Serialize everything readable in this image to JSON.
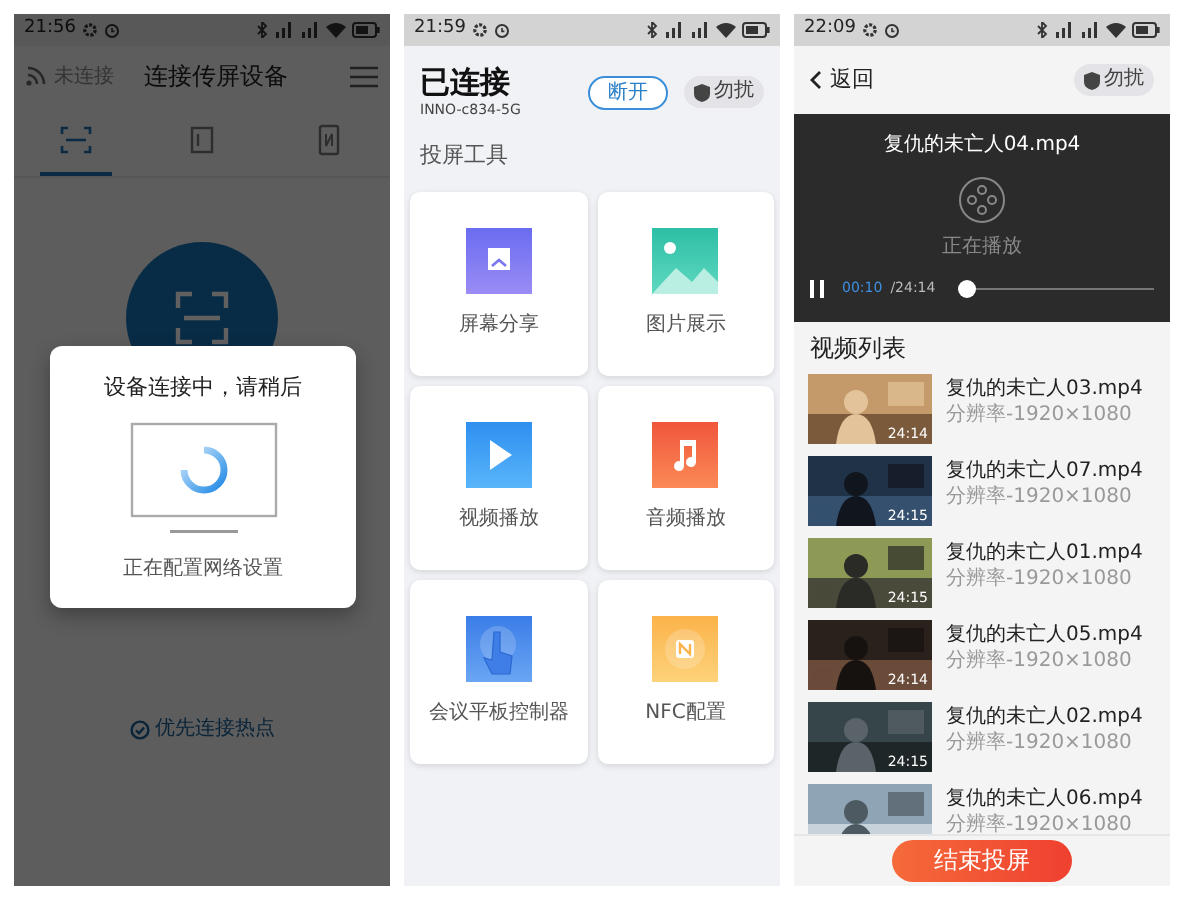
{
  "connect_screen": {
    "status_bar": {
      "time": "21:56"
    },
    "header": {
      "status": "未连接",
      "title": "连接传屏设备"
    },
    "tabs": [
      {
        "selected": true
      },
      {
        "selected": false
      },
      {
        "selected": false
      }
    ],
    "dialog": {
      "title": "设备连接中，请稍后",
      "message": "正在配置网络设置"
    },
    "hotspot_link": "优先连接热点"
  },
  "tools_screen": {
    "status_bar": {
      "time": "21:59"
    },
    "connection": {
      "status": "已连接",
      "network": "INNO-c834-5G"
    },
    "disconnect_button": "断开",
    "dnd_chip": "勿扰",
    "section_title": "投屏工具",
    "tools": [
      {
        "label": "屏幕分享",
        "kind": "screen"
      },
      {
        "label": "图片展示"
      },
      {
        "label": "视频播放",
        "kind": "video"
      },
      {
        "label": "音频播放",
        "kind": "audio"
      },
      {
        "label": "会议平板控制器",
        "kind": "touch"
      },
      {
        "label": "NFC配置",
        "kind": "nfc"
      }
    ]
  },
  "player_screen": {
    "status_bar": {
      "time": "22:09"
    },
    "back_button": "返回",
    "dnd_chip": "勿扰",
    "player": {
      "title": "复仇的未亡人04.mp4",
      "status": "正在播放",
      "elapsed": "00:10",
      "total": "/24:14",
      "level": 0.03
    },
    "list_title": "视频列表",
    "videos": [
      {
        "title": "复仇的未亡人03.mp4",
        "resolution": "分辨率-1920×1080",
        "duration": "24:14"
      },
      {
        "title": "复仇的未亡人07.mp4",
        "resolution": "分辨率-1920×1080",
        "duration": "24:15"
      },
      {
        "title": "复仇的未亡人01.mp4",
        "resolution": "分辨率-1920×1080",
        "duration": "24:15"
      },
      {
        "title": "复仇的未亡人05.mp4",
        "resolution": "分辨率-1920×1080",
        "duration": "24:14"
      },
      {
        "title": "复仇的未亡人02.mp4",
        "resolution": "分辨率-1920×1080",
        "duration": "24:15"
      },
      {
        "title": "复仇的未亡人06.mp4",
        "resolution": "分辨率-1920×1080"
      }
    ],
    "end_button": "结束投屏"
  }
}
